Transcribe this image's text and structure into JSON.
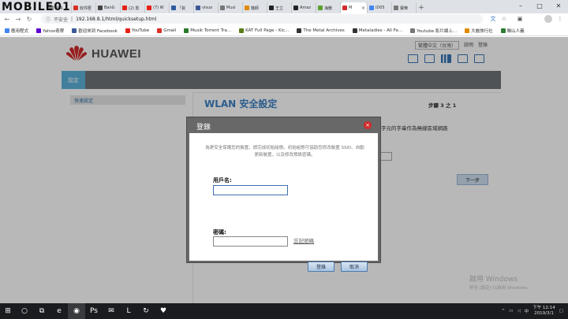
{
  "watermark": "MOBILE01",
  "browser": {
    "tabs": [
      {
        "label": "oaq",
        "color": "#8a8a8a"
      },
      {
        "label": "收件匣",
        "color": "#d93025"
      },
      {
        "label": "BanG",
        "color": "#444444"
      },
      {
        "label": "(2) 影",
        "color": "#e62117"
      },
      {
        "label": "(7) W",
        "color": "#e62117"
      },
      {
        "label": "「資",
        "color": "#2c5aa0"
      },
      {
        "label": "visuo",
        "color": "#3b5998"
      },
      {
        "label": "Musi",
        "color": "#777777"
      },
      {
        "label": "機師",
        "color": "#e08a00"
      },
      {
        "label": "王立",
        "color": "#222222"
      },
      {
        "label": "Amaz",
        "color": "#222222"
      },
      {
        "label": "海獸",
        "color": "#5aa02c"
      },
      {
        "label": "M",
        "color": "#d22a2a",
        "active": true
      },
      {
        "label": "iD05",
        "color": "#4285f4"
      },
      {
        "label": "寶樂",
        "color": "#777777"
      }
    ],
    "new_tab": "+",
    "window_controls": [
      "–",
      "□",
      "✕"
    ],
    "security_label": "不安全",
    "url": "192.168.8.1/html/quicksetup.html"
  },
  "bookmarks": [
    {
      "label": "應用程式",
      "color": "#4285f4"
    },
    {
      "label": "Yahoo奇摩",
      "color": "#5f01d1"
    },
    {
      "label": "歡迎來到 Facebook",
      "color": "#3b5998"
    },
    {
      "label": "YouTube",
      "color": "#e62117"
    },
    {
      "label": "Gmail",
      "color": "#d93025"
    },
    {
      "label": "Musik Torrent Tra...",
      "color": "#2a7a2a"
    },
    {
      "label": "KAT Full Page - Kic...",
      "color": "#5b7d1a"
    },
    {
      "label": "The Metal Archives",
      "color": "#333333"
    },
    {
      "label": "Metaladies - All Fe...",
      "color": "#333333"
    },
    {
      "label": "Youtube 影片線上...",
      "color": "#777777"
    },
    {
      "label": "大麗旅行社",
      "color": "#e08a00"
    },
    {
      "label": "閩山人義",
      "color": "#2e7d32"
    }
  ],
  "page": {
    "language": "繁體中文（台灣）",
    "help": "說明",
    "logout": "登錄",
    "brand": "HUAWEI",
    "nav_active": "設定",
    "sidebar_item": "快速設定",
    "title": "WLAN 安全設定",
    "step": "步驟 3 之 1",
    "hint": "字元的字串作為無線區域網路",
    "next_button": "下一步",
    "activation_title": "啟用 Windows",
    "activation_sub": "移至 [設定] 以啟用 Windows。"
  },
  "dialog": {
    "title": "登錄",
    "close": "×",
    "description": "為更安全保護您的裝置，請完成初始組態。初始組態可協助您修改裝置 SSID、自動更新裝置，以及修改預設密碼。",
    "username_label": "用戶名:",
    "username_value": "",
    "password_label": "密碼:",
    "password_value": "",
    "forgot_password": "忘記密碼",
    "login_button": "登錄",
    "cancel_button": "取消"
  },
  "taskbar": {
    "apps": [
      "⊞",
      "○",
      "⧉",
      "e",
      "◉",
      "Ps",
      "✉",
      "L",
      "↻",
      "♥"
    ],
    "time": "下午 12:14",
    "date": "2019/3/1",
    "ime": "中"
  },
  "colors": {
    "brand_red": "#d22a2a",
    "nav_active": "#5ab0d8",
    "title_blue": "#3c82c4"
  }
}
